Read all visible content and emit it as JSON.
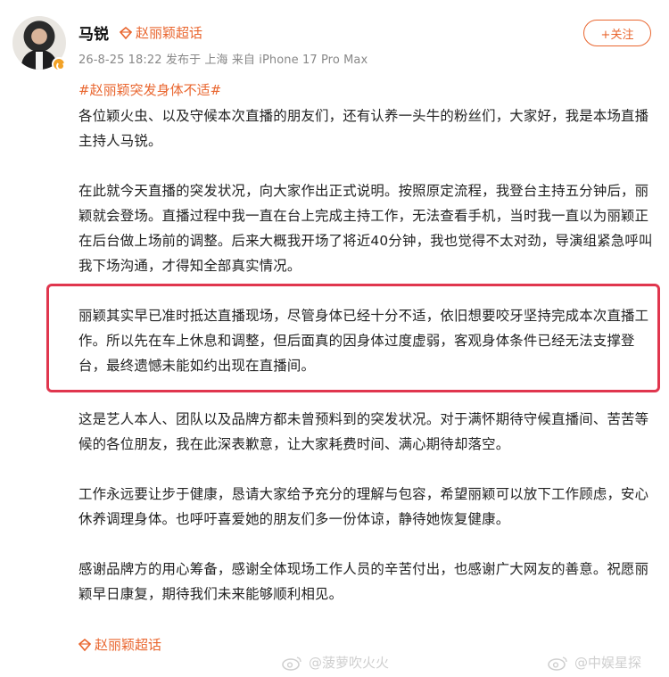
{
  "post": {
    "author": "马锐",
    "supertopic_link": "赵丽颖超话",
    "meta": "26-8-25 18:22 发布于 上海 来自 iPhone 17 Pro Max",
    "follow_label": "+关注",
    "topic_tag": "#赵丽颖突发身体不适#",
    "paragraphs": [
      "各位颖火虫、以及守候本次直播的朋友们，还有认养一头牛的粉丝们，大家好，我是本场直播主持人马锐。",
      "在此就今天直播的突发状况，向大家作出正式说明。按照原定流程，我登台主持五分钟后，丽颖就会登场。直播过程中我一直在台上完成主持工作，无法查看手机，当时我一直以为丽颖正在后台做上场前的调整。后来大概我开场了将近40分钟，我也觉得不太对劲，导演组紧急呼叫我下场沟通，才得知全部真实情况。",
      "丽颖其实早已准时抵达直播现场，尽管身体已经十分不适，依旧想要咬牙坚持完成本次直播工作。所以先在车上休息和调整，但后面真的因身体过度虚弱，客观身体条件已经无法支撑登台，最终遗憾未能如约出现在直播间。",
      "这是艺人本人、团队以及品牌方都未曾预料到的突发状况。对于满怀期待守候直播间、苦苦等候的各位朋友，我在此深表歉意，让大家耗费时间、满心期待却落空。",
      "工作永远要让步于健康，恳请大家给予充分的理解与包容，希望丽颖可以放下工作顾虑，安心休养调理身体。也呼吁喜爱她的朋友们多一份体谅，静待她恢复健康。",
      "感谢品牌方的用心筹备，感谢全体现场工作人员的辛苦付出，也感谢广大网友的善意。祝愿丽颖早日康复，期待我们未来能够顺利相见。"
    ],
    "bottom_topic": "赵丽颖超话"
  },
  "watermarks": [
    "@菠萝吹火火",
    "@中娱星探"
  ],
  "colors": {
    "accent": "#e9662f",
    "highlight_border": "#e0364e",
    "meta_text": "#888888"
  },
  "icons": {
    "supertopic": "diamond-icon",
    "verified": "verified-badge-icon",
    "watermark": "weibo-icon"
  }
}
